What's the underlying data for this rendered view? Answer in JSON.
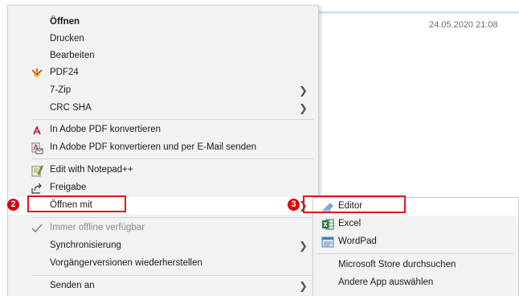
{
  "explorer": {
    "date": "24.05.2020 21:08"
  },
  "context_menu": {
    "items": [
      {
        "label": "Öffnen",
        "icon": ""
      },
      {
        "label": "Drucken",
        "icon": ""
      },
      {
        "label": "Bearbeiten",
        "icon": ""
      },
      {
        "label": "PDF24",
        "icon": "pdf24-icon"
      },
      {
        "label": "7-Zip",
        "icon": "",
        "submenu": true
      },
      {
        "label": "CRC SHA",
        "icon": "",
        "submenu": true
      },
      {
        "label": "In Adobe PDF konvertieren",
        "icon": "adobe-pdf-icon"
      },
      {
        "label": "In Adobe PDF konvertieren und per E-Mail senden",
        "icon": "adobe-pdf-mail-icon"
      },
      {
        "label": "Edit with Notepad++",
        "icon": "notepad-plus-plus-icon"
      },
      {
        "label": "Freigabe",
        "icon": "share-icon"
      },
      {
        "label": "Öffnen mit",
        "icon": "",
        "submenu": true
      },
      {
        "label": "Immer offline verfügbar",
        "icon": "checkmark-icon"
      },
      {
        "label": "Synchronisierung",
        "icon": "",
        "submenu": true
      },
      {
        "label": "Vorgängerversionen wiederherstellen",
        "icon": ""
      },
      {
        "label": "Senden an",
        "icon": "",
        "submenu": true
      }
    ]
  },
  "open_with_submenu": {
    "items": [
      {
        "label": "Editor",
        "icon": "notepad-icon"
      },
      {
        "label": "Excel",
        "icon": "excel-icon"
      },
      {
        "label": "WordPad",
        "icon": "wordpad-icon"
      },
      {
        "label": "Microsoft Store durchsuchen",
        "icon": ""
      },
      {
        "label": "Andere App auswählen",
        "icon": ""
      }
    ]
  },
  "step_badges": {
    "step2": "2",
    "step3": "3"
  },
  "colors": {
    "highlight_border": "#e0131f",
    "badge": "#d9000d",
    "menu_bg": "#f2f2f2"
  }
}
